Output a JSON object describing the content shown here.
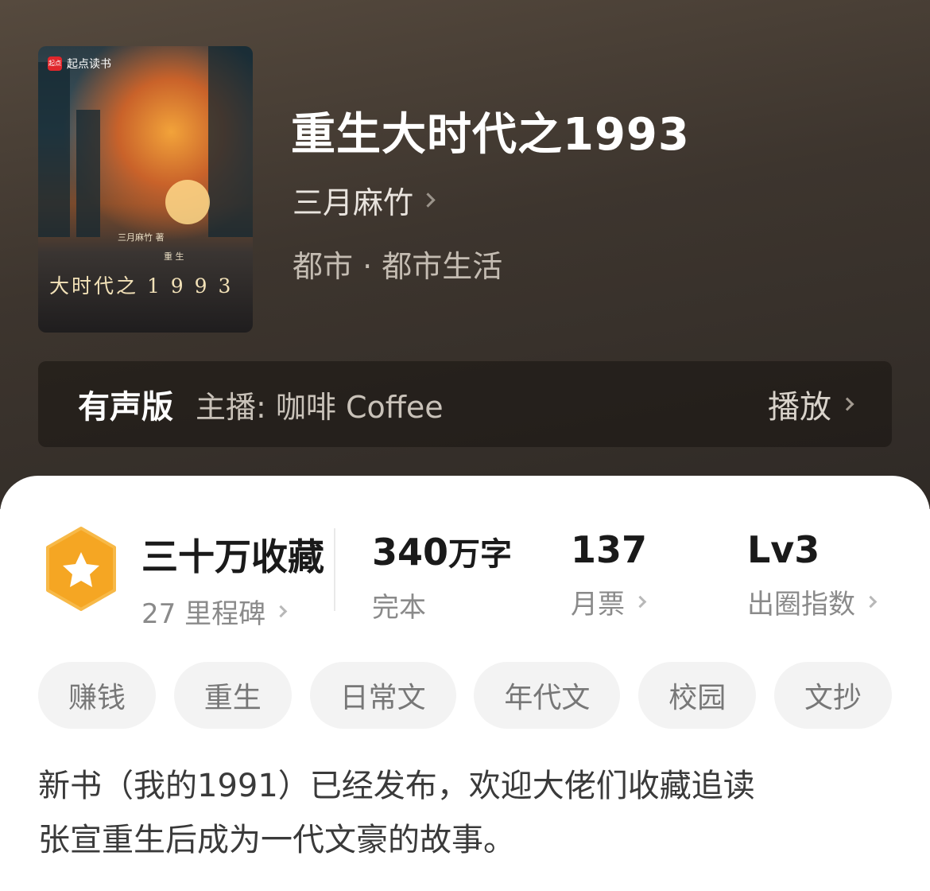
{
  "book": {
    "cover": {
      "brand": "起点读书",
      "brand_mark": "起点",
      "author_line": "三月麻竹 著",
      "subtitle": "重 生",
      "title": "大时代之 1 9 9 3"
    },
    "title": "重生大时代之1993",
    "author": "三月麻竹",
    "genre": "都市 · 都市生活"
  },
  "audio": {
    "label": "有声版",
    "host": "主播: 咖啡 Coffee",
    "play": "播放"
  },
  "stats": {
    "collection": {
      "value": "三十万收藏",
      "sub": "27 里程碑"
    },
    "words": {
      "value": "340",
      "unit": "万字",
      "sub": "完本"
    },
    "tickets": {
      "value": "137",
      "sub": "月票"
    },
    "index": {
      "value": "Lv3",
      "sub": "出圈指数"
    }
  },
  "tags": [
    "赚钱",
    "重生",
    "日常文",
    "年代文",
    "校园",
    "文抄"
  ],
  "description": [
    "新书（我的1991）已经发布，欢迎大佬们收藏追读",
    "张宣重生后成为一代文豪的故事。"
  ],
  "colors": {
    "hero_bg": "#3d352e",
    "medal": "#f5a623",
    "tag_bg": "#f3f3f3"
  }
}
